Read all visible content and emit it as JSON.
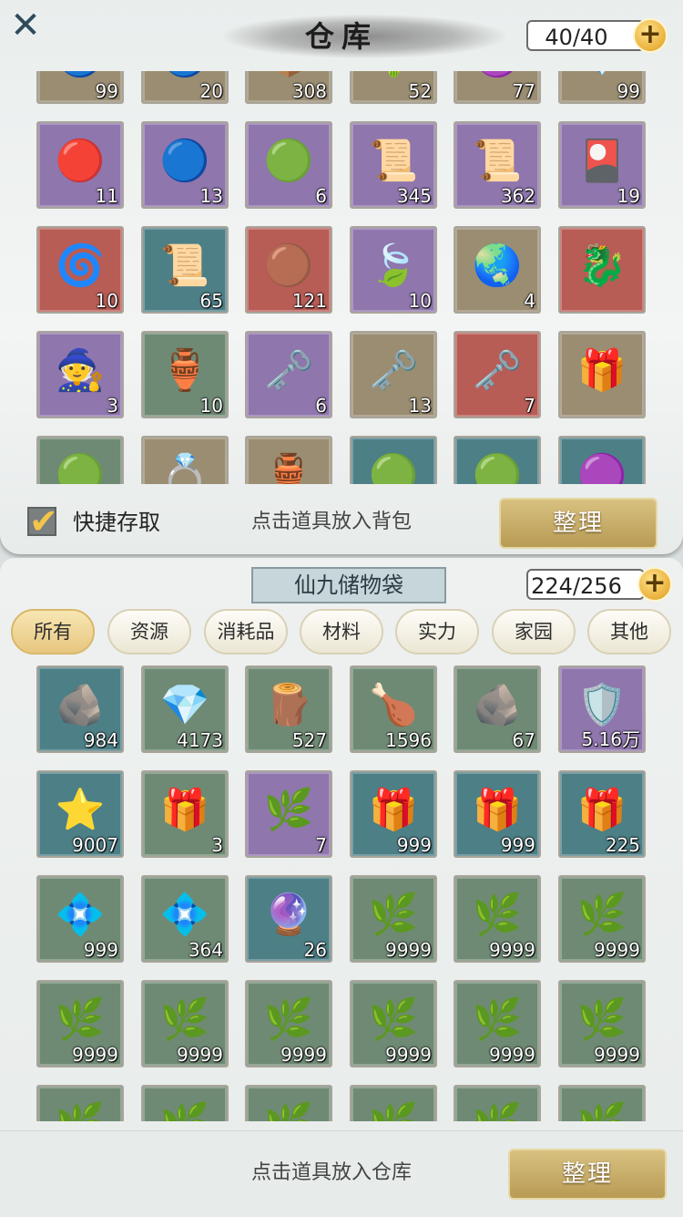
{
  "warehouse": {
    "title": "仓库",
    "capacity": "40/40",
    "quick_access_label": "快捷存取",
    "hint": "点击道具放入背包",
    "tidy_label": "整理",
    "items": [
      {
        "icon": "🔵",
        "count": "99",
        "bg": "tan"
      },
      {
        "icon": "🔵",
        "count": "20",
        "bg": "tan"
      },
      {
        "icon": "📦",
        "count": "308",
        "bg": "tan"
      },
      {
        "icon": "🌵",
        "count": "52",
        "bg": "tan"
      },
      {
        "icon": "🟣",
        "count": "77",
        "bg": "tan"
      },
      {
        "icon": "💎",
        "count": "99",
        "bg": "tan"
      },
      {
        "icon": "🔴",
        "count": "11",
        "bg": "purple"
      },
      {
        "icon": "🔵",
        "count": "13",
        "bg": "purple"
      },
      {
        "icon": "🟢",
        "count": "6",
        "bg": "purple"
      },
      {
        "icon": "📜",
        "count": "345",
        "bg": "purple"
      },
      {
        "icon": "📜",
        "count": "362",
        "bg": "purple"
      },
      {
        "icon": "🎴",
        "count": "19",
        "bg": "purple"
      },
      {
        "icon": "🌀",
        "count": "10",
        "bg": "red"
      },
      {
        "icon": "📜",
        "count": "65",
        "bg": "teal"
      },
      {
        "icon": "🟤",
        "count": "121",
        "bg": "red"
      },
      {
        "icon": "🍃",
        "count": "10",
        "bg": "purple"
      },
      {
        "icon": "🌏",
        "count": "4",
        "bg": "tan"
      },
      {
        "icon": "🐉",
        "count": "",
        "bg": "red"
      },
      {
        "icon": "🧙",
        "count": "3",
        "bg": "purple"
      },
      {
        "icon": "🏺",
        "count": "10",
        "bg": "green"
      },
      {
        "icon": "🗝️",
        "count": "6",
        "bg": "purple"
      },
      {
        "icon": "🗝️",
        "count": "13",
        "bg": "tan"
      },
      {
        "icon": "🗝️",
        "count": "7",
        "bg": "red"
      },
      {
        "icon": "🎁",
        "count": "",
        "bg": "tan"
      },
      {
        "icon": "🟢",
        "count": "",
        "bg": "green"
      },
      {
        "icon": "💍",
        "count": "",
        "bg": "tan"
      },
      {
        "icon": "🏺",
        "count": "",
        "bg": "tan"
      },
      {
        "icon": "🟢",
        "count": "",
        "bg": "teal"
      },
      {
        "icon": "🟢",
        "count": "",
        "bg": "teal"
      },
      {
        "icon": "🟣",
        "count": "",
        "bg": "teal"
      }
    ]
  },
  "bag": {
    "title": "仙九储物袋",
    "capacity": "224/256",
    "tabs": [
      "所有",
      "资源",
      "消耗品",
      "材料",
      "实力",
      "家园",
      "其他"
    ],
    "active_tab": 0,
    "hint": "点击道具放入仓库",
    "tidy_label": "整理",
    "items": [
      {
        "icon": "🪨",
        "count": "984",
        "bg": "teal"
      },
      {
        "icon": "💎",
        "count": "4173",
        "bg": "green"
      },
      {
        "icon": "🪵",
        "count": "527",
        "bg": "green"
      },
      {
        "icon": "🍗",
        "count": "1596",
        "bg": "green"
      },
      {
        "icon": "🪨",
        "count": "67",
        "bg": "green"
      },
      {
        "icon": "🛡️",
        "count": "5.16万",
        "bg": "purple"
      },
      {
        "icon": "⭐",
        "count": "9007",
        "bg": "teal"
      },
      {
        "icon": "🎁",
        "count": "3",
        "bg": "green"
      },
      {
        "icon": "🌿",
        "count": "7",
        "bg": "purple"
      },
      {
        "icon": "🎁",
        "count": "999",
        "bg": "teal"
      },
      {
        "icon": "🎁",
        "count": "999",
        "bg": "teal"
      },
      {
        "icon": "🎁",
        "count": "225",
        "bg": "teal"
      },
      {
        "icon": "💠",
        "count": "999",
        "bg": "green"
      },
      {
        "icon": "💠",
        "count": "364",
        "bg": "green"
      },
      {
        "icon": "🔮",
        "count": "26",
        "bg": "teal"
      },
      {
        "icon": "🌿",
        "count": "9999",
        "bg": "green"
      },
      {
        "icon": "🌿",
        "count": "9999",
        "bg": "green"
      },
      {
        "icon": "🌿",
        "count": "9999",
        "bg": "green"
      },
      {
        "icon": "🌿",
        "count": "9999",
        "bg": "green"
      },
      {
        "icon": "🌿",
        "count": "9999",
        "bg": "green"
      },
      {
        "icon": "🌿",
        "count": "9999",
        "bg": "green"
      },
      {
        "icon": "🌿",
        "count": "9999",
        "bg": "green"
      },
      {
        "icon": "🌿",
        "count": "9999",
        "bg": "green"
      },
      {
        "icon": "🌿",
        "count": "9999",
        "bg": "green"
      },
      {
        "icon": "🌿",
        "count": "",
        "bg": "green"
      },
      {
        "icon": "🌿",
        "count": "",
        "bg": "green"
      },
      {
        "icon": "🌿",
        "count": "",
        "bg": "green"
      },
      {
        "icon": "🌿",
        "count": "",
        "bg": "green"
      },
      {
        "icon": "🌿",
        "count": "",
        "bg": "green"
      },
      {
        "icon": "🌿",
        "count": "",
        "bg": "green"
      }
    ]
  },
  "icons": {
    "close": "close-icon",
    "plus": "plus-icon",
    "check": "checkmark-icon"
  },
  "glyphs": {
    "close": "✕",
    "plus": "+",
    "check": "✔"
  }
}
